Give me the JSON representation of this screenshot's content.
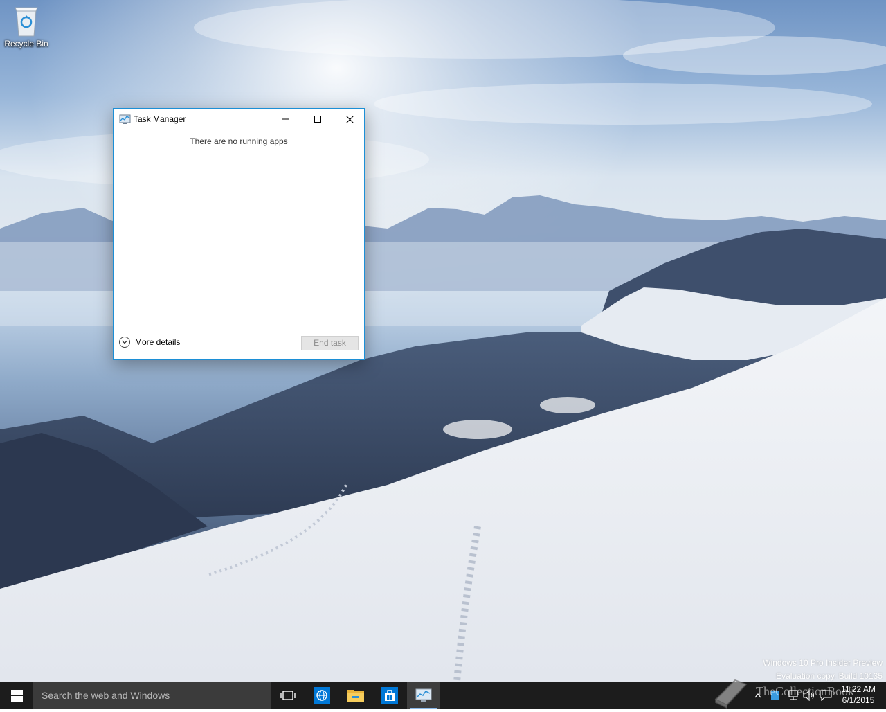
{
  "desktop": {
    "icons": [
      {
        "label": "Recycle Bin",
        "icon": "recycle-bin-icon"
      }
    ],
    "watermark": {
      "line1": "Windows 10 Pro Insider Preview",
      "line2": "Evaluation copy. Build 10135"
    },
    "site_mark": "TheCollectionBook"
  },
  "task_manager": {
    "title": "Task Manager",
    "empty_message": "There are no running apps",
    "more_details_label": "More details",
    "end_task_label": "End task",
    "end_task_enabled": false
  },
  "taskbar": {
    "search_placeholder": "Search the web and Windows",
    "pinned": [
      {
        "name": "task-view",
        "icon": "task-view-icon"
      },
      {
        "name": "edge",
        "icon": "edge-browser-icon"
      },
      {
        "name": "file-explorer",
        "icon": "folder-icon"
      },
      {
        "name": "store",
        "icon": "store-icon"
      },
      {
        "name": "task-manager",
        "icon": "task-manager-icon",
        "active": true
      }
    ],
    "clock": {
      "time": "11:22 AM",
      "date": "6/1/2015"
    }
  },
  "colors": {
    "window_border": "#1c8fd6",
    "taskbar": "#1c1c1c",
    "search_box": "#3b3b3b",
    "accent": "#0078d7"
  }
}
